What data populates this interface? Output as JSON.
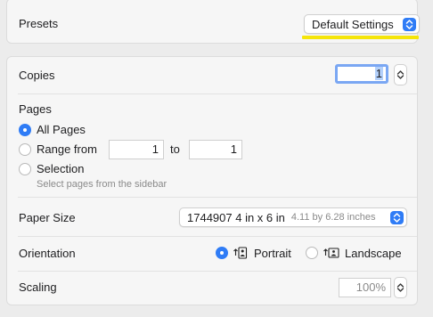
{
  "presets": {
    "label": "Presets",
    "value": "Default Settings"
  },
  "copies": {
    "label": "Copies",
    "value": "1"
  },
  "pages": {
    "label": "Pages",
    "all_pages": "All Pages",
    "range_from": "Range from",
    "range_start": "1",
    "to": "to",
    "range_end": "1",
    "selection": "Selection",
    "selection_hint": "Select pages from the sidebar",
    "selected": "all_pages"
  },
  "paper_size": {
    "label": "Paper Size",
    "value": "1744907 4 in x 6 in",
    "detail": "4.11 by 6.28 inches"
  },
  "orientation": {
    "label": "Orientation",
    "portrait": "Portrait",
    "landscape": "Landscape",
    "selected": "portrait"
  },
  "scaling": {
    "label": "Scaling",
    "value": "100%"
  },
  "colors": {
    "accent": "#2f7cf6",
    "highlight": "#f5e50a"
  }
}
